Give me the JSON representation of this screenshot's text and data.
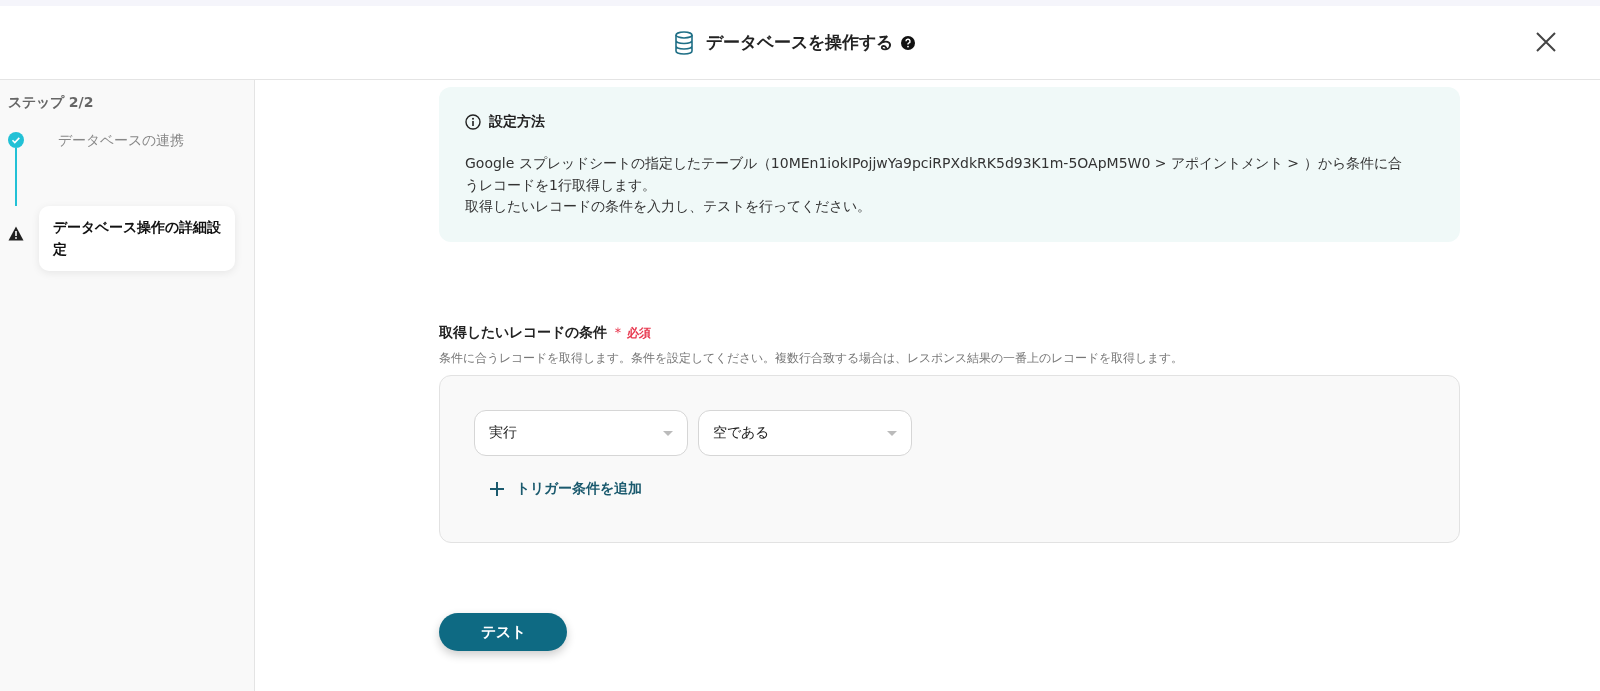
{
  "header": {
    "title": "データベースを操作する"
  },
  "sidebar": {
    "heading": "ステップ 2/2",
    "steps": [
      {
        "label": "データベースの連携",
        "kind": "done",
        "selected": false
      },
      {
        "label": "データベース操作の詳細設定",
        "kind": "warning",
        "selected": true
      }
    ]
  },
  "info": {
    "title": "設定方法",
    "lines": [
      "Google スプレッドシートの指定したテーブル（10MEn1iokIPojjwYa9pciRPXdkRK5d93K1m-5OApM5W0 > アポイントメント > ）から条件に合うレコードを1行取得します。",
      "取得したいレコードの条件を入力し、テストを行ってください。"
    ]
  },
  "condition": {
    "label": "取得したいレコードの条件",
    "required_mark": "＊",
    "required": "必須",
    "help": "条件に合うレコードを取得します。条件を設定してください。複数行合致する場合は、レスポンス結果の一番上のレコードを取得します。",
    "selects": [
      {
        "value": "実行"
      },
      {
        "value": "空である"
      }
    ],
    "add_button": "トリガー条件を追加"
  },
  "test_button": "テスト"
}
